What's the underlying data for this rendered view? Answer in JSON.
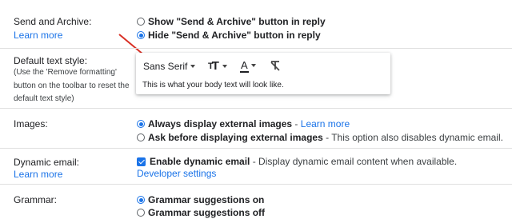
{
  "send_archive": {
    "label": "Send and Archive:",
    "learn_more": "Learn more",
    "options": [
      {
        "label": "Show \"Send & Archive\" button in reply",
        "selected": false
      },
      {
        "label": "Hide \"Send & Archive\" button in reply",
        "selected": true
      }
    ]
  },
  "default_text_style": {
    "label": "Default text style:",
    "help_lines": [
      "(Use the 'Remove formatting'",
      "button on the toolbar to reset the",
      "default text style)"
    ],
    "font_name": "Sans Serif",
    "size_glyph": "T",
    "text_color_glyph": "A",
    "preview_text": "This is what your body text will look like.",
    "text_color_underline": "#202124"
  },
  "images": {
    "label": "Images:",
    "options": [
      {
        "bold": "Always display external images",
        "sep": " - ",
        "link": "Learn more",
        "selected": true
      },
      {
        "bold": "Ask before displaying external images",
        "desc": " - This option also disables dynamic email.",
        "selected": false
      }
    ]
  },
  "dynamic_email": {
    "label": "Dynamic email:",
    "learn_more": "Learn more",
    "checkbox_bold": "Enable dynamic email",
    "checkbox_desc": " - Display dynamic email content when available.",
    "checked": true,
    "developer_settings": "Developer settings"
  },
  "grammar": {
    "label": "Grammar:",
    "options": [
      {
        "label": "Grammar suggestions on",
        "selected": true
      },
      {
        "label": "Grammar suggestions off",
        "selected": false
      }
    ]
  },
  "colors": {
    "accent": "#1a73e8",
    "arrow": "#d93025",
    "divider": "#e0e0e0"
  }
}
